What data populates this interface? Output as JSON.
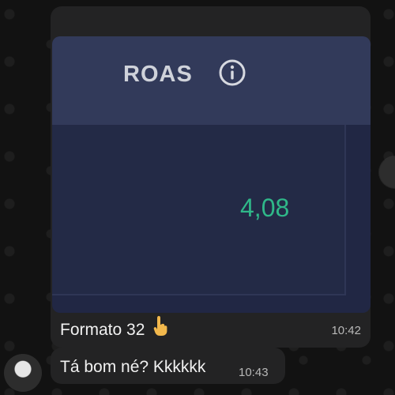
{
  "media_message": {
    "image": {
      "title": "ROAS",
      "info_icon": "info-circle-icon",
      "value": "4,08",
      "colors": {
        "header_bg": "#323a5a",
        "body_bg": "#232a46",
        "value_color": "#2fb889",
        "title_color": "#cfd2da"
      }
    },
    "caption": "Formato 32",
    "emoji_icon": "pointing-up-hand-icon",
    "time": "10:42"
  },
  "text_message": {
    "text": "Tá bom né? Kkkkkk",
    "time": "10:43"
  },
  "avatar": {
    "icon": "user-avatar-icon"
  },
  "scroll_button": {
    "icon": "scroll-to-bottom-icon"
  },
  "colors": {
    "chat_bg": "#121212",
    "bubble_bg": "#232324",
    "text": "#f1f1f1",
    "time": "#b8b8b8"
  }
}
